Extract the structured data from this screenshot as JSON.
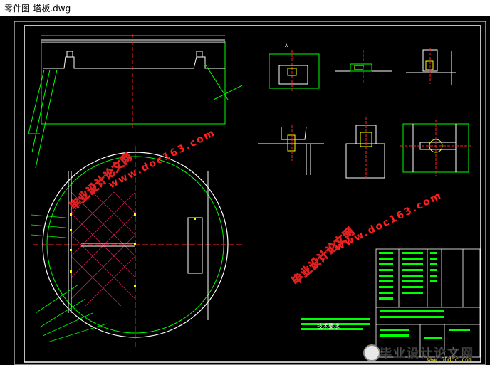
{
  "window": {
    "title": "零件图-塔板.dwg"
  },
  "watermarks": {
    "cn_text": "毕业设计论文网",
    "url_text": "www.doc163.com"
  },
  "drawing": {
    "tech_requirements_title": "技术要求"
  },
  "footer": {
    "cn_text": "毕业设计论文网",
    "url_text": "www.56doc.com"
  },
  "colors": {
    "background": "#000000",
    "frame": "#ffffff",
    "outline": "#00ff00",
    "center_line": "#ff2020",
    "hatch": "#c02050",
    "watermark": "#e02020"
  }
}
